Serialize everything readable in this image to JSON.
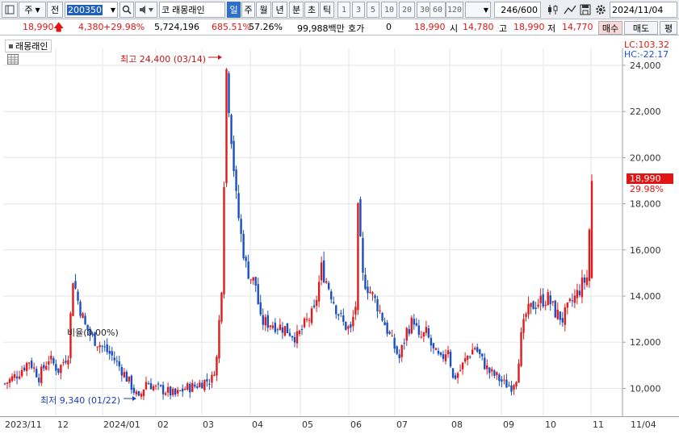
{
  "toolbar": {
    "market_type": "주",
    "prev_label": "전",
    "stock_code": "200350",
    "stock_name": "래몽래인",
    "code_prefix": "코",
    "period_buttons": [
      "일",
      "주",
      "월",
      "년",
      "분",
      "초",
      "틱"
    ],
    "active_period": "일",
    "interval_buttons": [
      "1",
      "3",
      "5",
      "10",
      "20",
      "30",
      "60",
      "120"
    ],
    "count": "246",
    "count_total": "/600",
    "date": "2024/11/04"
  },
  "quote": {
    "price": "18,990",
    "change": "4,380",
    "change_pct": "+29.98%",
    "volume": "5,724,196",
    "volume_ratio": "685.51%",
    "turnover": "57.26%",
    "amount": "99,988백만",
    "hoga_label": "호가",
    "hoga_value": "0",
    "ask": "18,990",
    "open_label": "시",
    "open": "14,780",
    "high_label": "고",
    "high": "18,990",
    "low_label": "저",
    "low": "14,770",
    "buy_label": "매수",
    "sell_label": "매도",
    "eval_label": "평"
  },
  "chart_panel": {
    "legend": "래몽래인",
    "lc": "LC:103.32",
    "hc": "HC:-22.17",
    "current_price_tag": "18,990",
    "current_pct_tag": "29.98%",
    "high_annotation": "최고 24,400 (03/14)",
    "low_annotation": "최저 9,340 (01/22)",
    "mid_annotation": "비율(0.00%)"
  },
  "chart_data": {
    "type": "candlestick",
    "y_ticks": [
      "24,000",
      "22,000",
      "20,000",
      "18,000",
      "16,000",
      "14,000",
      "12,000",
      "10,000"
    ],
    "ylim": [
      9000,
      24800
    ],
    "x_ticks": [
      "2023/11",
      "12",
      "2024/01",
      "02",
      "03",
      "04",
      "05",
      "06",
      "07",
      "08",
      "09",
      "10",
      "11",
      "11/04"
    ],
    "up_color": "#e01b1b",
    "down_color": "#1a4fc4",
    "segments": [
      [
        0,
        10200
      ],
      [
        5,
        10600
      ],
      [
        10,
        11200
      ],
      [
        14,
        10500
      ],
      [
        18,
        11300
      ],
      [
        22,
        10800
      ],
      [
        26,
        11500
      ],
      [
        28,
        14800
      ],
      [
        30,
        13800
      ],
      [
        33,
        12700
      ],
      [
        36,
        12200
      ],
      [
        40,
        11800
      ],
      [
        44,
        11400
      ],
      [
        48,
        10800
      ],
      [
        52,
        10100
      ],
      [
        55,
        9500
      ],
      [
        58,
        10300
      ],
      [
        62,
        10000
      ],
      [
        66,
        9900
      ],
      [
        70,
        9700
      ],
      [
        74,
        10000
      ],
      [
        78,
        10100
      ],
      [
        82,
        10300
      ],
      [
        85,
        10400
      ],
      [
        87,
        11300
      ],
      [
        89,
        14500
      ],
      [
        91,
        23800
      ],
      [
        93,
        21000
      ],
      [
        95,
        18200
      ],
      [
        97,
        16600
      ],
      [
        99,
        15300
      ],
      [
        101,
        14800
      ],
      [
        103,
        14500
      ],
      [
        105,
        12900
      ],
      [
        110,
        12800
      ],
      [
        115,
        12600
      ],
      [
        120,
        12200
      ],
      [
        124,
        12900
      ],
      [
        127,
        13300
      ],
      [
        130,
        15200
      ],
      [
        133,
        14400
      ],
      [
        136,
        13500
      ],
      [
        139,
        12800
      ],
      [
        142,
        12500
      ],
      [
        144,
        13600
      ],
      [
        145,
        17600
      ],
      [
        147,
        14800
      ],
      [
        150,
        14200
      ],
      [
        153,
        13600
      ],
      [
        156,
        12800
      ],
      [
        159,
        12000
      ],
      [
        162,
        11300
      ],
      [
        165,
        12500
      ],
      [
        168,
        13000
      ],
      [
        170,
        12100
      ],
      [
        173,
        12400
      ],
      [
        176,
        11600
      ],
      [
        179,
        11200
      ],
      [
        182,
        11800
      ],
      [
        184,
        10400
      ],
      [
        187,
        10800
      ],
      [
        190,
        11400
      ],
      [
        193,
        11800
      ],
      [
        196,
        11200
      ],
      [
        199,
        10700
      ],
      [
        202,
        10500
      ],
      [
        205,
        10200
      ],
      [
        208,
        10100
      ],
      [
        210,
        10500
      ],
      [
        212,
        12200
      ],
      [
        214,
        13200
      ],
      [
        217,
        13600
      ],
      [
        220,
        13800
      ],
      [
        223,
        13900
      ],
      [
        226,
        13300
      ],
      [
        229,
        13000
      ],
      [
        232,
        13600
      ],
      [
        235,
        14100
      ],
      [
        237,
        14500
      ],
      [
        239,
        14800
      ],
      [
        241,
        18990
      ]
    ]
  }
}
